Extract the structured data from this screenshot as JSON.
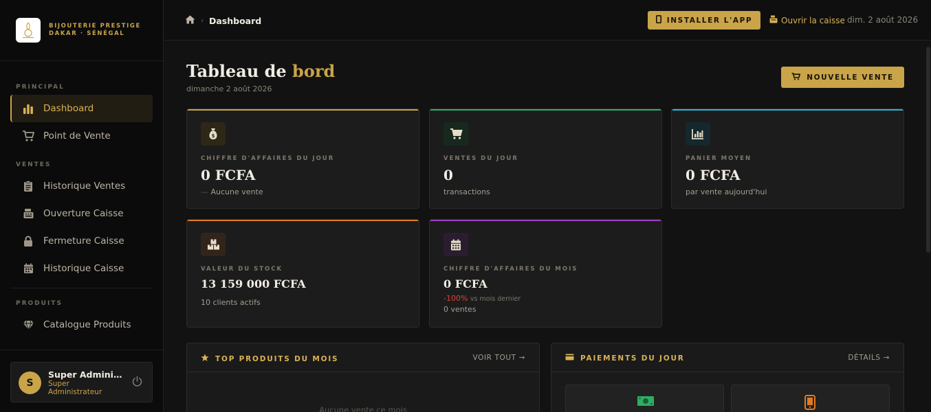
{
  "brand": {
    "line1": "BIJOUTERIE PRESTIGE",
    "line2": "DAKAR · SÉNÉGAL"
  },
  "sidebar": {
    "sections": [
      {
        "label": "PRINCIPAL"
      },
      {
        "label": "VENTES"
      },
      {
        "label": "PRODUITS"
      }
    ],
    "items": [
      {
        "label": "Dashboard",
        "icon": "chart-bar-icon"
      },
      {
        "label": "Point de Vente",
        "icon": "cart-icon"
      },
      {
        "label": "Historique Ventes",
        "icon": "clipboard-icon"
      },
      {
        "label": "Ouverture Caisse",
        "icon": "cash-register-icon"
      },
      {
        "label": "Fermeture Caisse",
        "icon": "lock-icon"
      },
      {
        "label": "Historique Caisse",
        "icon": "calendar-icon"
      },
      {
        "label": "Catalogue Produits",
        "icon": "gem-icon"
      }
    ]
  },
  "user": {
    "initial": "S",
    "name": "Super Administrateur",
    "role": "Super Administrateur"
  },
  "topbar": {
    "breadcrumb": "Dashboard",
    "install_label": "INSTALLER L'APP",
    "open_cash_label": "Ouvrir la caisse",
    "date": "dim. 2 août 2026"
  },
  "page": {
    "title_main": "Tableau de ",
    "title_accent": "bord",
    "subtitle": "dimanche 2 août 2026",
    "new_sale_label": "NOUVELLE VENTE"
  },
  "stats": {
    "revenue_day": {
      "label": "CHIFFRE D'AFFAIRES DU JOUR",
      "value": "0 FCFA",
      "dash": "—",
      "note": "Aucune vente"
    },
    "sales_day": {
      "label": "VENTES DU JOUR",
      "value": "0",
      "note": "transactions"
    },
    "avg_basket": {
      "label": "PANIER MOYEN",
      "value": "0 FCFA",
      "note": "par vente aujourd'hui"
    },
    "stock_value": {
      "label": "VALEUR DU STOCK",
      "value": "13 159 000 FCFA",
      "note": "10 clients actifs"
    },
    "revenue_month": {
      "label": "CHIFFRE D'AFFAIRES DU MOIS",
      "value": "0 FCFA",
      "change": "-100%",
      "change_note": "vs mois dernier",
      "note": "0 ventes"
    }
  },
  "colors": {
    "gold": "#c9a449",
    "green": "#2fae63",
    "cyan": "#2bb5d8",
    "orange": "#e07a24",
    "purple": "#9b3fc2",
    "red": "#e0433a"
  },
  "panels": {
    "top_products": {
      "title": "TOP PRODUITS DU MOIS",
      "link": "VOIR TOUT →",
      "empty": "Aucune vente ce mois"
    },
    "payments": {
      "title": "PAIEMENTS DU JOUR",
      "link": "DÉTAILS →"
    }
  }
}
